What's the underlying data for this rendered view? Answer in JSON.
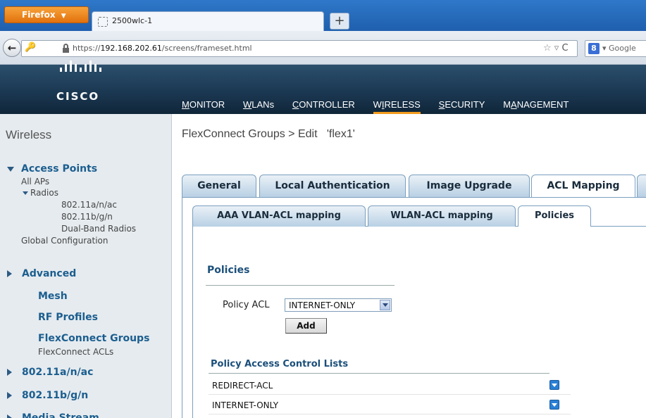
{
  "browser": {
    "menu_button": "Firefox",
    "tab_title": "2500wlc-1",
    "url_prefix": "https://",
    "url_host": "192.168.202.61",
    "url_path": "/screens/frameset.html",
    "search_placeholder": "Google"
  },
  "header": {
    "logo_text": "CISCO",
    "nav": [
      {
        "label": "MONITOR",
        "underline": "M",
        "rest": "ONITOR"
      },
      {
        "label": "WLANs",
        "underline": "W",
        "rest": "LANs"
      },
      {
        "label": "CONTROLLER",
        "underline": "C",
        "rest": "ONTROLLER"
      },
      {
        "label": "WIRELESS",
        "underline": "I",
        "rest": "RELESS",
        "pre": "W"
      },
      {
        "label": "SECURITY",
        "underline": "S",
        "rest": "ECURITY"
      },
      {
        "label": "MANAGEMENT",
        "underline": "A",
        "rest": "NAGEMENT",
        "pre": "M"
      }
    ],
    "active_nav": "WIRELESS"
  },
  "sidebar": {
    "title": "Wireless",
    "access_points": "Access Points",
    "all_aps": "All APs",
    "radios": "Radios",
    "radio_80211anac": "802.11a/n/ac",
    "radio_80211bgn": "802.11b/g/n",
    "dual_band": "Dual-Band Radios",
    "global_config": "Global Configuration",
    "advanced": "Advanced",
    "mesh": "Mesh",
    "rf_profiles": "RF Profiles",
    "flexconnect_groups": "FlexConnect Groups",
    "flexconnect_acls": "FlexConnect ACLs",
    "band_a": "802.11a/n/ac",
    "band_b": "802.11b/g/n",
    "media_stream": "Media Stream"
  },
  "main": {
    "page_title": "FlexConnect Groups > Edit   'flex1'",
    "tabs": [
      "General",
      "Local Authentication",
      "Image Upgrade",
      "ACL Mapping"
    ],
    "active_tab": "ACL Mapping",
    "subtabs": [
      "AAA VLAN-ACL mapping",
      "WLAN-ACL mapping",
      "Policies"
    ],
    "active_subtab": "Policies",
    "section_title": "Policies",
    "policy_acl_label": "Policy ACL",
    "policy_acl_value": "INTERNET-ONLY",
    "add_button": "Add",
    "list_title": "Policy Access Control Lists",
    "acl_rows": [
      "REDIRECT-ACL",
      "INTERNET-ONLY"
    ]
  },
  "colors": {
    "accent_orange": "#f29b1d",
    "header_blue": "#1a3650",
    "link_blue": "#1b5e8f"
  }
}
